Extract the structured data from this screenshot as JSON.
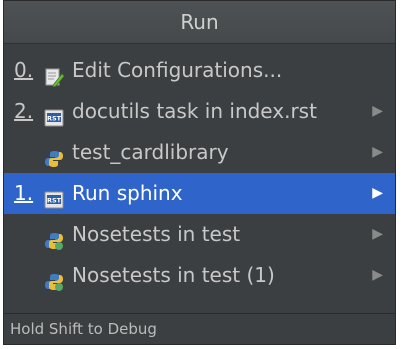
{
  "popup": {
    "title": "Run",
    "footer_hint": "Hold Shift to Debug",
    "items": [
      {
        "mnemonic": "0.",
        "label": "Edit Configurations...",
        "icon": "edit-configurations-icon",
        "submenu": false,
        "selected": false
      },
      {
        "mnemonic": "2.",
        "label": "docutils task in index.rst",
        "icon": "rst-file-icon",
        "submenu": true,
        "selected": false
      },
      {
        "mnemonic": "",
        "label": "test_cardlibrary",
        "icon": "python-icon",
        "submenu": true,
        "selected": false
      },
      {
        "mnemonic": "1.",
        "label": "Run sphinx",
        "icon": "rst-file-icon",
        "submenu": true,
        "selected": true
      },
      {
        "mnemonic": "",
        "label": "Nosetests in test",
        "icon": "python-test-icon",
        "submenu": true,
        "selected": false
      },
      {
        "mnemonic": "",
        "label": "Nosetests in test (1)",
        "icon": "python-test-icon",
        "submenu": true,
        "selected": false
      }
    ]
  },
  "colors": {
    "popup_bg": "#3c3f41",
    "selection_bg": "#2f65ca",
    "text": "#c8c8c8"
  }
}
